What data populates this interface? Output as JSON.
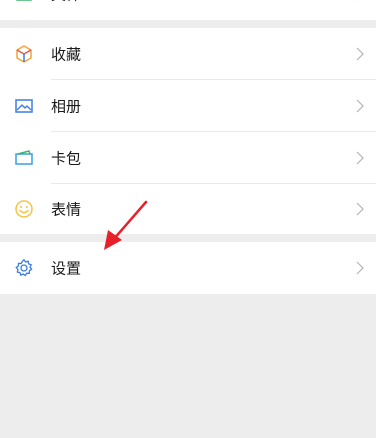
{
  "partial_item": {
    "label": "文件",
    "icon": "folder-icon"
  },
  "menu_items": [
    {
      "label": "收藏",
      "icon": "favorites-cube-icon",
      "icon_color": "#f2a33a"
    },
    {
      "label": "相册",
      "icon": "album-image-icon",
      "icon_color": "#3c7de0"
    },
    {
      "label": "卡包",
      "icon": "card-wallet-icon",
      "icon_color": "#3a9de6"
    },
    {
      "label": "表情",
      "icon": "emoji-smile-icon",
      "icon_color": "#f5c343"
    }
  ],
  "settings_item": {
    "label": "设置",
    "icon": "gear-icon",
    "icon_color": "#3c7de0"
  },
  "colors": {
    "background": "#ededed",
    "row": "#ffffff",
    "text": "#1a1a1a",
    "chevron": "#b3b3b3",
    "annotation_arrow": "#e8202a"
  }
}
